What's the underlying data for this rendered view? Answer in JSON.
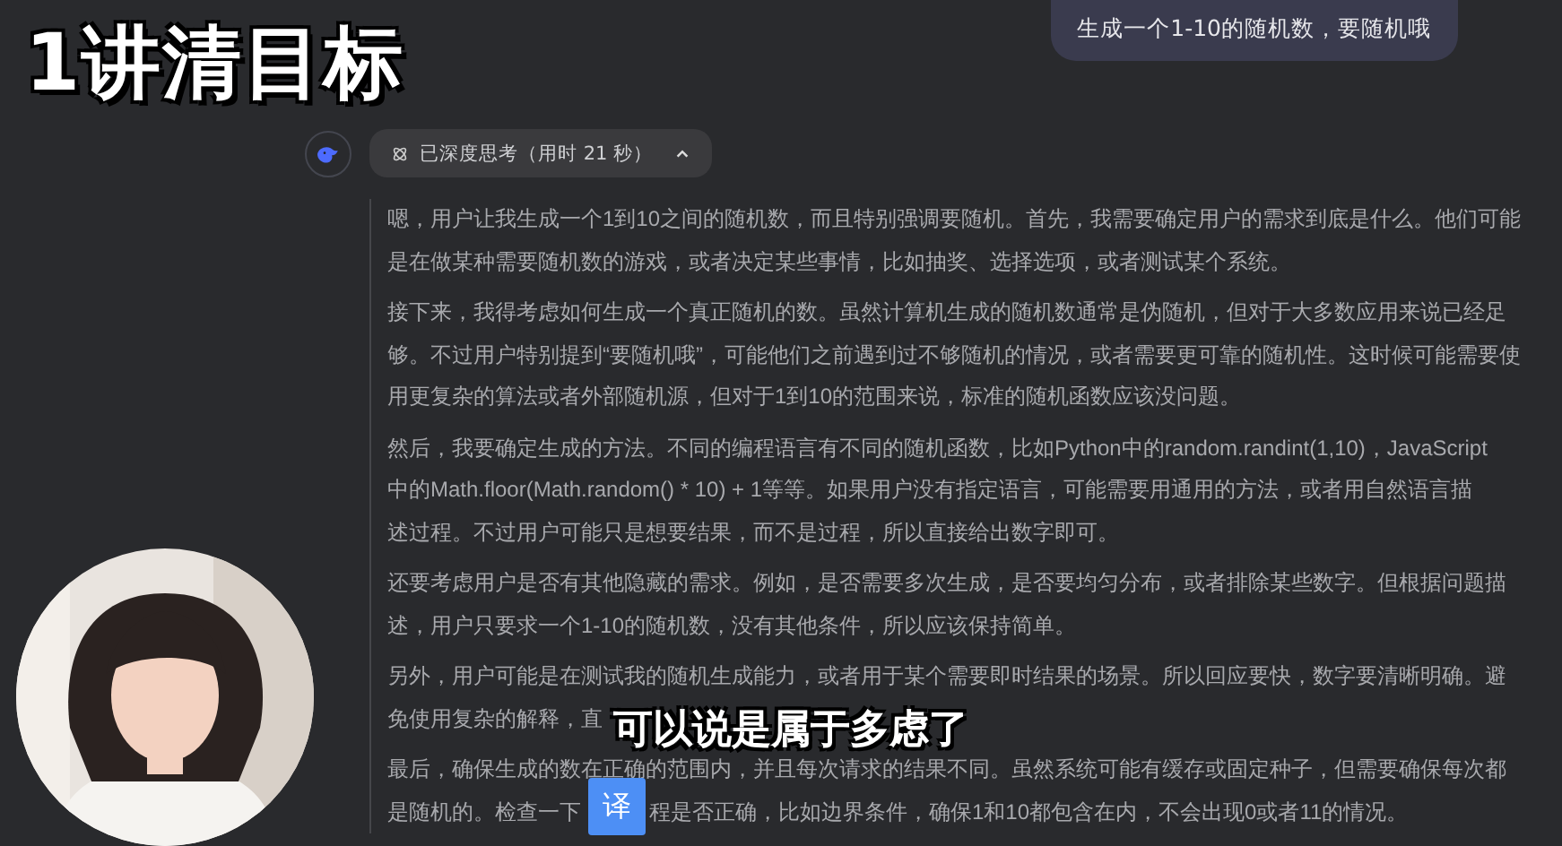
{
  "overlay_title": "1讲清目标",
  "user_message": "生成一个1-10的随机数，要随机哦",
  "thinking": {
    "label": "已深度思考（用时 21 秒）",
    "expanded": true
  },
  "paragraphs": [
    {
      "lines": [
        [
          "嗯，用户让我生成一个1到10之间的随机数，而且特别强调要随机。首先，我需要确定用户的需求到底是什么。他们可能"
        ],
        [
          "是在做某种需要随机数的游戏，或者决定某些事情，比如抽奖、选择选项，或者测试某个系统。"
        ]
      ]
    },
    {
      "lines": [
        [
          "接下来，我得考虑如何生成一个真正随机的数。虽然计算机生成的随机数通常是伪随机，但对于大多数应用来说已经足"
        ],
        [
          "够。不过用户特别提到“要随机哦”，可能他们之前遇到过不够随机的情况，或者需要更可靠的随机性。这时候可能需要使"
        ],
        [
          "用更复杂的算法或者外部随机源，但对于1到10的范围来说，标准的随机函数应该没问题。"
        ]
      ]
    },
    {
      "lines": [
        [
          "然后，我要确定生成的方法。不同的编程语言有不同的随机函数，比如Python中的random.randint(1,10)，JavaScript"
        ],
        [
          "中的Math.floor(Math.random() * 10) + 1等等。如果用户没有指定语言，可能需要用通用的方法，或者用自然语言描"
        ],
        [
          "述过程。不过用户可能只是想要结果，而不是过程，所以直接给出数字即可。"
        ]
      ]
    },
    {
      "lines": [
        [
          "还要考虑用户是否有其他隐藏的需求。例如，是否需要多次生成，是否要均匀分布，或者排除某些数字。但根据问题描"
        ],
        [
          "述，用户只要求一个1-10的随机数，没有其他条件，所以应该保持简单。"
        ]
      ]
    },
    {
      "lines": [
        [
          "另外，用户可能是在测试我的随机生成能力，或者用于某个需要即时结果的场景。所以回应要快，数字要清晰明确。避"
        ],
        [
          "免使用复杂的解释，直"
        ]
      ]
    },
    {
      "lines": [
        [
          "最后，确保生成的数在正确的范围内，并且每次请求的结果不同。虽然系统可能有缓存或固定种子，但需要确保每次都"
        ],
        [
          "是随机的。检查一下",
          "程是否正确，比如边界条件，确保1和10都包含在内，不会出现0或者11的情况。"
        ]
      ]
    }
  ],
  "subtitle": "可以说是属于多虑了",
  "translate_button": "译"
}
